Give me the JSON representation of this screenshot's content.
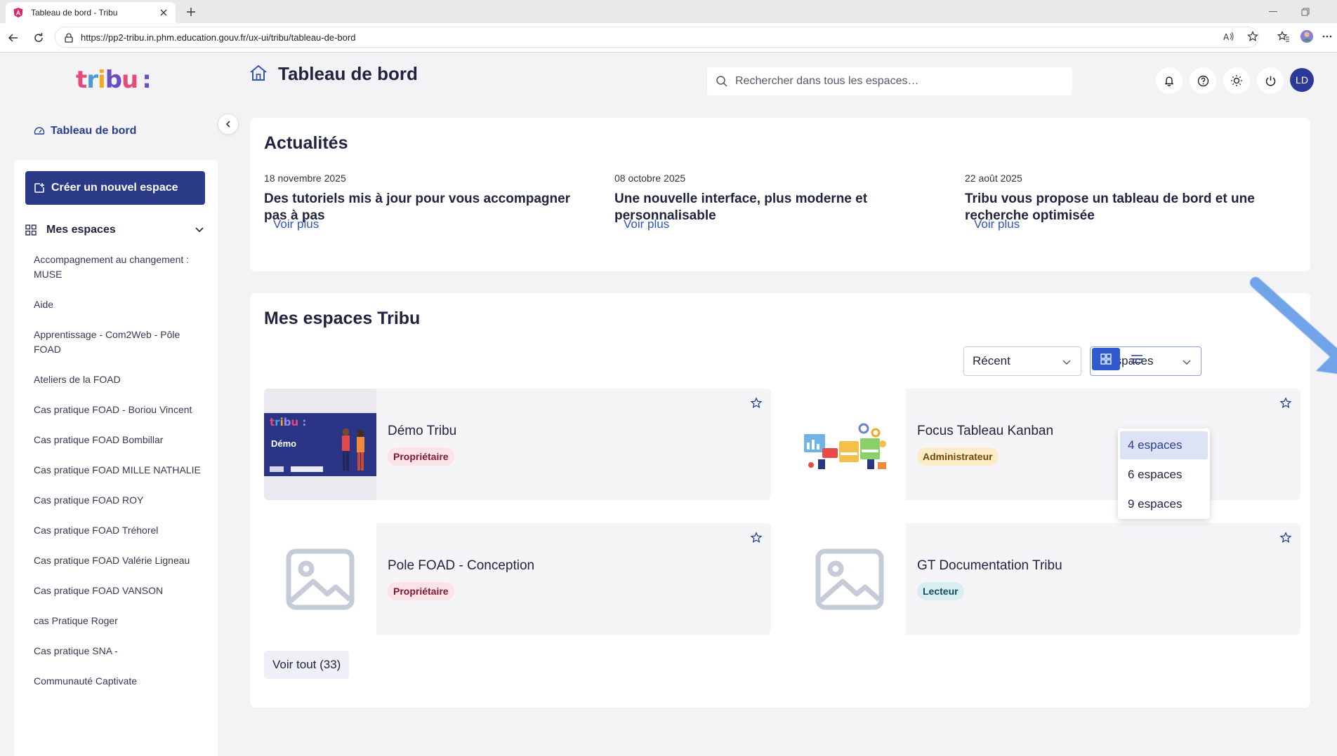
{
  "browser": {
    "tab_title": "Tableau de bord - Tribu",
    "url": "https://pp2-tribu.in.phm.education.gouv.fr/ux-ui/tribu/tableau-de-bord"
  },
  "sidebar": {
    "logo": {
      "t": "t",
      "r": "r",
      "i": "i",
      "b": "b",
      "u": "u",
      "colon": ":"
    },
    "dashboard_link": "Tableau de bord",
    "create_button": "Créer un nouvel espace",
    "mes_espaces_label": "Mes espaces",
    "espaces": [
      "Accompagnement au changement : MUSE",
      "Aide",
      "Apprentissage - Com2Web - Pôle FOAD",
      "Ateliers de la FOAD",
      "Cas pratique FOAD - Boriou Vincent",
      "Cas pratique FOAD Bombillar",
      "Cas pratique FOAD MILLE NATHALIE",
      "Cas pratique FOAD ROY",
      "Cas pratique FOAD Tréhorel",
      "Cas pratique FOAD Valérie Ligneau",
      "Cas pratique FOAD VANSON",
      "cas Pratique Roger",
      "Cas pratique SNA -",
      "Communauté Captivate"
    ]
  },
  "header": {
    "page_title": "Tableau de bord",
    "search_placeholder": "Rechercher dans tous les espaces…",
    "avatar_initials": "LD"
  },
  "news": {
    "title": "Actualités",
    "items": [
      {
        "date": "18 novembre 2025",
        "headline": "Des tutoriels mis à jour pour vous accompagner pas à pas",
        "more": "Voir plus"
      },
      {
        "date": "08 octobre 2025",
        "headline": "Une nouvelle interface, plus moderne et personnalisable",
        "more": "Voir plus"
      },
      {
        "date": "22 août 2025",
        "headline": "Tribu vous propose un tableau de bord et une recherche optimisée",
        "more": "Voir plus"
      }
    ]
  },
  "espaces_section": {
    "title": "Mes espaces Tribu",
    "sort_value": "Récent",
    "count_value": "4 espaces",
    "count_options": [
      "4 espaces",
      "6 espaces",
      "9 espaces"
    ],
    "cards": [
      {
        "title": "Démo Tribu",
        "role": "Propriétaire",
        "thumb_text": "Démo"
      },
      {
        "title": "Focus Tableau Kanban",
        "role": "Administrateur"
      },
      {
        "title": "Pole FOAD - Conception",
        "role": "Propriétaire"
      },
      {
        "title": "GT Documentation Tribu",
        "role": "Lecteur"
      }
    ],
    "view_all": "Voir tout (33)"
  },
  "colors": {
    "primary": "#2b3a86",
    "link": "#2f56b8",
    "arrow": "#6fa3e8"
  }
}
